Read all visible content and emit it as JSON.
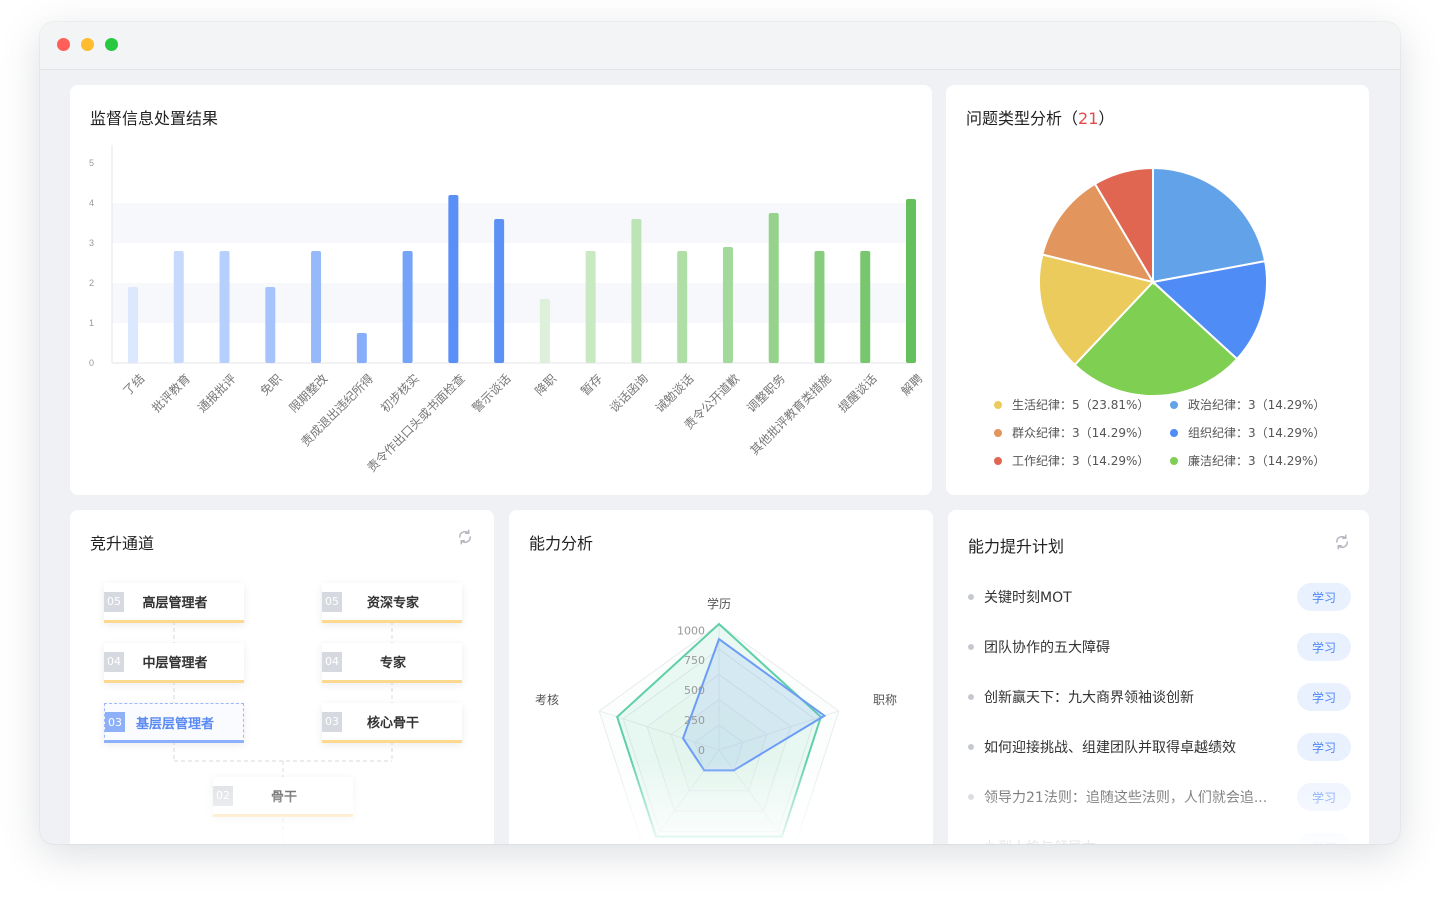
{
  "window": {
    "dots": [
      "#ff5f57",
      "#febc2e",
      "#28c840"
    ]
  },
  "supervision": {
    "title": "监督信息处置结果",
    "chart_data": {
      "type": "bar",
      "ylim": [
        0,
        5
      ],
      "yticks": [
        0,
        1,
        2,
        3,
        4,
        5
      ],
      "categories": [
        "了结",
        "批评教育",
        "通报批评",
        "免职",
        "限期整改",
        "责成退出违纪所得",
        "初步核实",
        "责令作出口头或书面检查",
        "警示谈话",
        "降职",
        "暂存",
        "谈话函询",
        "诫勉谈话",
        "责令公开道歉",
        "调整职务",
        "其他批评教育类措施",
        "提醒谈话",
        "解聘"
      ],
      "values": [
        1.9,
        2.8,
        2.8,
        1.9,
        2.8,
        0.75,
        2.8,
        4.2,
        3.6,
        1.6,
        2.8,
        3.6,
        2.8,
        2.9,
        3.75,
        2.8,
        2.8,
        4.1
      ],
      "colors": [
        "#dce8fd",
        "#c7dafd",
        "#b7cffc",
        "#a6c4fb",
        "#96b9fa",
        "#86aefa",
        "#75a3f9",
        "#5b8ff8",
        "#5d91f6",
        "#dcf0da",
        "#c9e9c3",
        "#bde4b5",
        "#b0dea7",
        "#a3d99a",
        "#95d38c",
        "#86cd7e",
        "#78c76f",
        "#67c05e"
      ]
    }
  },
  "issues": {
    "title": "问题类型分析（",
    "count": "21",
    "title_end": "）",
    "chart_data": {
      "type": "pie",
      "slices": [
        {
          "name": "政治纪律",
          "value": 3,
          "percent": "14.29%",
          "color": "#62a2e8"
        },
        {
          "name": "组织纪律",
          "value": 3,
          "percent": "14.29%",
          "color": "#4f8cf5"
        },
        {
          "name": "廉洁纪律",
          "value": 3,
          "percent": "14.29%",
          "color": "#7ecf52"
        },
        {
          "name": "生活纪律",
          "value": 5,
          "percent": "23.81%",
          "color": "#ebcb5c"
        },
        {
          "name": "群众纪律",
          "value": 3,
          "percent": "14.29%",
          "color": "#e2955c"
        },
        {
          "name": "工作纪律",
          "value": 3,
          "percent": "14.29%",
          "color": "#e06651"
        }
      ],
      "drawn_shares": [
        0.2208,
        0.1473,
        0.2524,
        0.1683,
        0.1262,
        0.085
      ]
    },
    "legend": [
      {
        "text": "生活纪律：5（23.81%）",
        "color": "#ebcb5c"
      },
      {
        "text": "政治纪律：3（14.29%）",
        "color": "#62a2e8"
      },
      {
        "text": "群众纪律：3（14.29%）",
        "color": "#e2955c"
      },
      {
        "text": "组织纪律：3（14.29%）",
        "color": "#4f8cf5"
      },
      {
        "text": "工作纪律：3（14.29%）",
        "color": "#e06651"
      },
      {
        "text": "廉洁纪律：3（14.29%）",
        "color": "#7ecf52"
      }
    ]
  },
  "promotion": {
    "title": "竞升通道",
    "refresh_icon": "refresh-icon",
    "nodes": [
      {
        "num": "05",
        "label": "高层管理者",
        "active": false
      },
      {
        "num": "05",
        "label": "资深专家",
        "active": false
      },
      {
        "num": "04",
        "label": "中层管理者",
        "active": false
      },
      {
        "num": "04",
        "label": "专家",
        "active": false
      },
      {
        "num": "03",
        "label": "基层层管理者",
        "active": true
      },
      {
        "num": "03",
        "label": "核心骨干",
        "active": false
      },
      {
        "num": "02",
        "label": "骨干",
        "active": false
      }
    ]
  },
  "ability": {
    "title": "能力分析",
    "chart_data": {
      "type": "radar",
      "indicators": [
        "学历",
        "职称",
        "",
        "",
        "考核"
      ],
      "max": 1000,
      "ticks": [
        "0",
        "250",
        "500",
        "750",
        "1000"
      ],
      "series": [
        {
          "values": [
            1000,
            850,
            850,
            850,
            850
          ],
          "color": "#5fd0a6"
        },
        {
          "values": [
            880,
            880,
            200,
            200,
            300
          ],
          "color": "#6c9cf6"
        }
      ]
    }
  },
  "plan": {
    "title": "能力提升计划",
    "refresh_icon": "refresh-icon",
    "items": [
      {
        "text": "关键时刻MOT",
        "button": "学习"
      },
      {
        "text": "团队协作的五大障碍",
        "button": "学习"
      },
      {
        "text": "创新赢天下：九大商界领袖谈创新",
        "button": "学习"
      },
      {
        "text": "如何迎接挑战、组建团队并取得卓越绩效",
        "button": "学习"
      },
      {
        "text": "领导力21法则：追随这些法则，人们就会追...",
        "button": "学习"
      },
      {
        "text": "九型人格与领导力",
        "button": "学习"
      }
    ]
  }
}
